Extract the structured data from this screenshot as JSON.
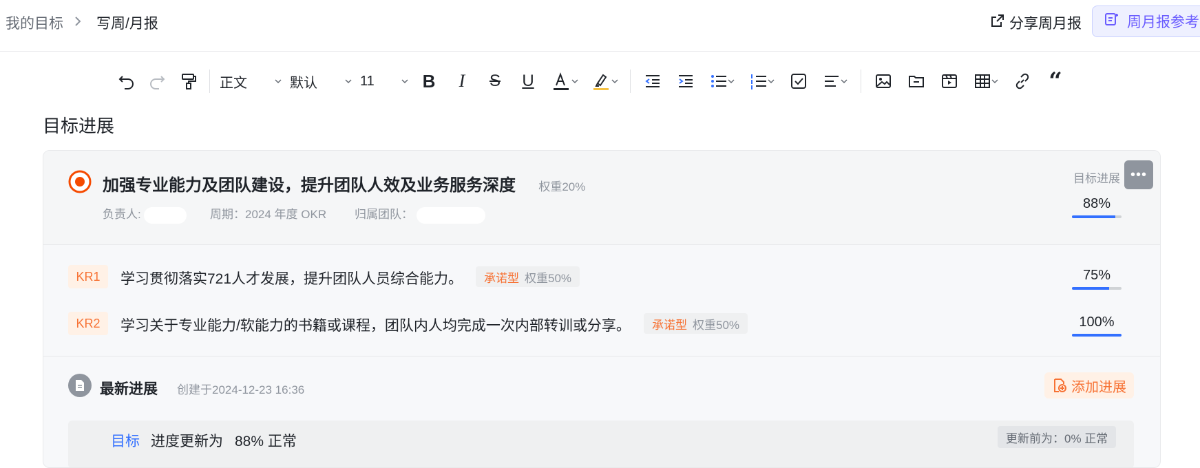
{
  "header": {
    "breadcrumb_root": "我的目标",
    "breadcrumb_current": "写周/月报",
    "share_label": "分享周月报",
    "reference_label": "周月报参考"
  },
  "toolbar": {
    "style_select": "正文",
    "font_select": "默认",
    "size_select": "11",
    "text_color": "#1f2329",
    "highlight_color": "#f5c142"
  },
  "section_title": "目标进展",
  "objective": {
    "title": "加强专业能力及团队建设，提升团队人效及业务服务深度",
    "weight": "权重20%",
    "owner_label": "负责人:",
    "period": "周期：2024 年度 OKR",
    "team_label": "归属团队：",
    "progress_label": "目标进展",
    "progress_text": "88%",
    "progress_value": 0.88,
    "more_label": "•••"
  },
  "key_results": [
    {
      "tag": "KR1",
      "text": "学习贯彻落实721人才发展，提升团队人员综合能力。",
      "type": "承诺型",
      "weight": "权重50%",
      "progress_text": "75%",
      "progress_value": 0.75
    },
    {
      "tag": "KR2",
      "text": "学习关于专业能力/软能力的书籍或课程，团队内人均完成一次内部转训或分享。",
      "type": "承诺型",
      "weight": "权重50%",
      "progress_text": "100%",
      "progress_value": 1.0
    }
  ],
  "latest": {
    "title": "最新进展",
    "created": "创建于2024-12-23 16:36",
    "add_label": "添加进展",
    "update": {
      "object": "目标",
      "text": "进度更新为",
      "value": "88% 正常",
      "before": "更新前为：0% 正常"
    }
  },
  "colors": {
    "accent": "#3370ff",
    "orange": "#f77234",
    "objective_icon": "#f54a00"
  }
}
